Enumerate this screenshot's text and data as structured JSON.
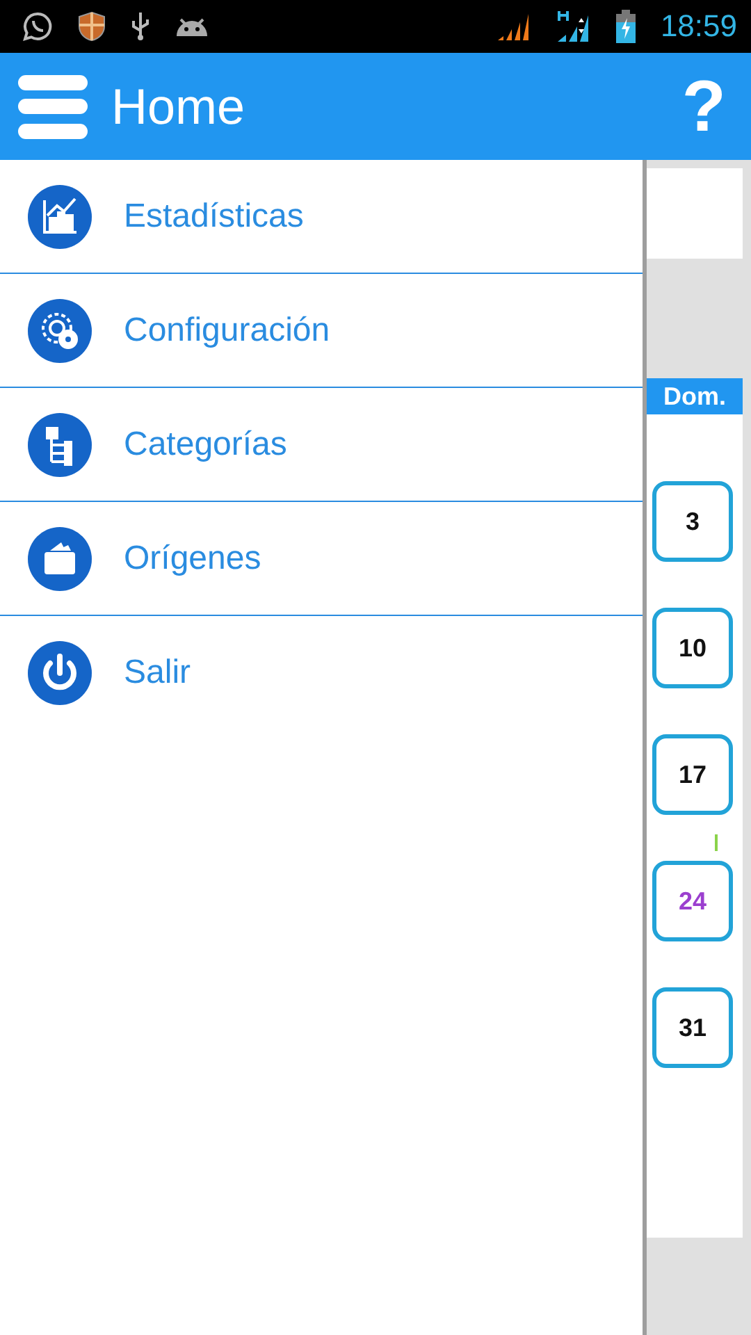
{
  "status_bar": {
    "time": "18:59"
  },
  "app_bar": {
    "title": "Home",
    "help": "?"
  },
  "drawer": {
    "items": [
      {
        "label": "Estadísticas"
      },
      {
        "label": "Configuración"
      },
      {
        "label": "Categorías"
      },
      {
        "label": "Orígenes"
      },
      {
        "label": "Salir"
      }
    ]
  },
  "calendar": {
    "column_header": "Dom.",
    "days": [
      {
        "label": "3",
        "highlighted": false,
        "marked": false
      },
      {
        "label": "10",
        "highlighted": false,
        "marked": false
      },
      {
        "label": "17",
        "highlighted": false,
        "marked": false
      },
      {
        "label": "24",
        "highlighted": true,
        "marked": true
      },
      {
        "label": "31",
        "highlighted": false,
        "marked": false
      }
    ]
  }
}
